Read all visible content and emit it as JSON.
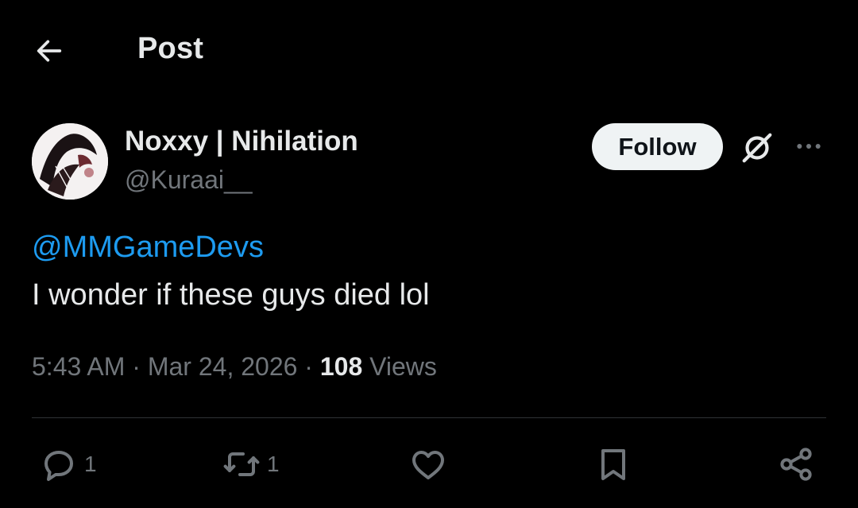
{
  "header": {
    "back_icon": "arrow-left-icon",
    "title": "Post"
  },
  "author": {
    "display_name": "Noxxy | Nihilation",
    "handle": "@Kuraai__",
    "avatar_icon": "avatar-image"
  },
  "actions_top": {
    "follow_label": "Follow",
    "grok_icon": "grok-icon",
    "more_icon": "more-horizontal-icon"
  },
  "post": {
    "mention": "@MMGameDevs",
    "text": "I wonder if these guys died lol"
  },
  "meta": {
    "time": "5:43 AM",
    "separator": "·",
    "date": "Mar 24, 2026",
    "views_count": "108",
    "views_label": "Views"
  },
  "engagement": {
    "reply_count": "1",
    "repost_count": "1",
    "icons": [
      "reply-icon",
      "repost-icon",
      "like-icon",
      "bookmark-icon",
      "share-icon"
    ]
  },
  "colors": {
    "background": "#000000",
    "text_primary": "#e7e9ea",
    "text_secondary": "#71767b",
    "link": "#1d9bf0",
    "follow_bg": "#eff3f4",
    "divider": "#2f3336"
  }
}
